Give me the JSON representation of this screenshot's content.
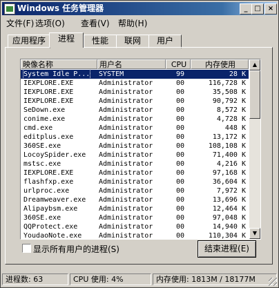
{
  "window": {
    "title": "Windows 任务管理器",
    "buttons": {
      "minimize": "_",
      "maximize": "□",
      "close": "×"
    }
  },
  "menu": [
    "文件(F)",
    "选项(O)",
    "查看(V)",
    "帮助(H)"
  ],
  "tabs": [
    {
      "label": "应用程序",
      "active": false
    },
    {
      "label": "进程",
      "active": true
    },
    {
      "label": "性能",
      "active": false
    },
    {
      "label": "联网",
      "active": false
    },
    {
      "label": "用户",
      "active": false
    }
  ],
  "table": {
    "headers": [
      "映像名称",
      "用户名",
      "CPU",
      "内存使用"
    ],
    "rows": [
      [
        "System Idle P...",
        "SYSTEM",
        "99",
        "28 K"
      ],
      [
        "IEXPLORE.EXE",
        "Administrator",
        "00",
        "116,728 K"
      ],
      [
        "IEXPLORE.EXE",
        "Administrator",
        "00",
        "35,508 K"
      ],
      [
        "IEXPLORE.EXE",
        "Administrator",
        "00",
        "90,792 K"
      ],
      [
        "SeDown.exe",
        "Administrator",
        "00",
        "8,572 K"
      ],
      [
        "conime.exe",
        "Administrator",
        "00",
        "4,728 K"
      ],
      [
        "cmd.exe",
        "Administrator",
        "00",
        "448 K"
      ],
      [
        "editplus.exe",
        "Administrator",
        "00",
        "13,172 K"
      ],
      [
        "360SE.exe",
        "Administrator",
        "00",
        "108,108 K"
      ],
      [
        "LocoySpider.exe",
        "Administrator",
        "00",
        "71,400 K"
      ],
      [
        "mstsc.exe",
        "Administrator",
        "00",
        "4,216 K"
      ],
      [
        "IEXPLORE.EXE",
        "Administrator",
        "00",
        "97,168 K"
      ],
      [
        "flashfxp.exe",
        "Administrator",
        "00",
        "36,604 K"
      ],
      [
        "urlproc.exe",
        "Administrator",
        "00",
        "7,972 K"
      ],
      [
        "Dreamweaver.exe",
        "Administrator",
        "00",
        "13,696 K"
      ],
      [
        "Alipaybsm.exe",
        "Administrator",
        "00",
        "12,464 K"
      ],
      [
        "360SE.exe",
        "Administrator",
        "00",
        "97,048 K"
      ],
      [
        "QQProtect.exe",
        "Administrator",
        "00",
        "14,940 K"
      ],
      [
        "YoudaoNote.exe",
        "Administrator",
        "00",
        "110,304 K"
      ]
    ],
    "selected_index": 0
  },
  "show_all_users_label": "显示所有用户的进程(S)",
  "end_process_label": "结束进程(E)",
  "status": {
    "processes": "进程数: 63",
    "cpu": "CPU 使用: 4%",
    "memory": "内存使用: 1813M / 18177M"
  },
  "colors": {
    "titlebar": "#0a246a",
    "selection": "#0a246a",
    "face": "#d4d0c8"
  }
}
